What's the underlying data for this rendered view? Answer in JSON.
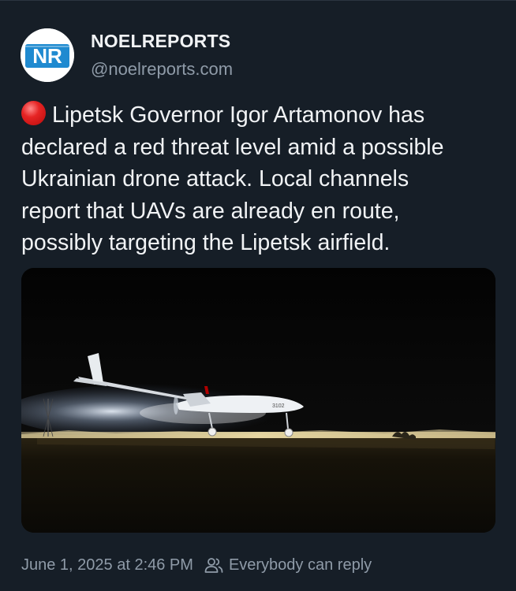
{
  "author": {
    "display_name": "NOELREPORTS",
    "handle": "@noelreports.com",
    "avatar_text": "NR"
  },
  "post": {
    "lines": [
      "Lipetsk Governor Igor Artamonov has",
      "declared a red threat level amid a possible",
      "Ukrainian drone attack. Local channels",
      "report that UAVs are already en route,",
      "possibly targeting the Lipetsk airfield."
    ],
    "leading_icon": "red-circle-icon"
  },
  "media": {
    "aircraft_marking": "3102"
  },
  "footer": {
    "timestamp": "June 1, 2025 at 2:46 PM",
    "reply_setting": "Everybody can reply",
    "reply_icon": "people-icon"
  },
  "colors": {
    "background": "#161e27",
    "text": "#f1f3f5",
    "muted": "#8f9ba8",
    "avatar_blue": "#1f8ad0"
  }
}
